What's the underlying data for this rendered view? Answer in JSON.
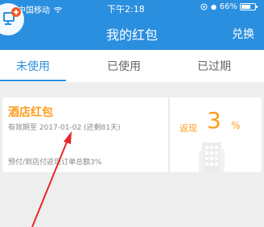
{
  "status_bar": {
    "carrier": "中国移动",
    "time": "下午2:18",
    "battery": "66%",
    "battery_level": 0.66
  },
  "header": {
    "title": "我的红包",
    "exchange_label": "兑换"
  },
  "tabs": [
    {
      "label": "未使用",
      "active": true
    },
    {
      "label": "已使用",
      "active": false
    },
    {
      "label": "已过期",
      "active": false
    }
  ],
  "coupons": [
    {
      "name": "酒店红包",
      "expiry": "有效期至 2017-01-02 (还剩81天)",
      "description": "预付/到店付返现订单总额3%",
      "rebate_label": "返现",
      "rebate_value": "3",
      "rebate_unit": "%"
    }
  ],
  "colors": {
    "primary": "#2b8fe0",
    "accent": "#ff9b1a",
    "annotation_arrow": "#e8262b"
  },
  "icons": [
    "wifi-icon",
    "alarm-icon",
    "location-icon",
    "battery-icon",
    "back-icon",
    "hotel-building-icon",
    "annotation-arrow-icon"
  ]
}
